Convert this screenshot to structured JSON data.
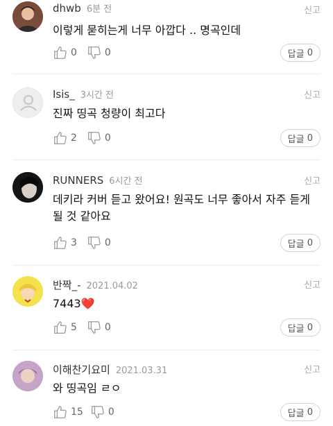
{
  "ui": {
    "like_icon": "thumbs-up-icon",
    "dislike_icon": "thumbs-down-icon",
    "accent": "#e33e3e"
  },
  "comments": [
    {
      "user": "dhwb",
      "time": "6분 전",
      "report": "신고",
      "text": "이렇게 묻히는게 너무 아깝다 .. 명곡인데",
      "likes": "0",
      "dislikes": "0",
      "reply_label": "답글",
      "reply_count": "0"
    },
    {
      "user": "Isis_",
      "time": "3시간 전",
      "report": "신고",
      "text": "진짜 띵곡 청량이 최고다",
      "likes": "2",
      "dislikes": "0",
      "reply_label": "답글",
      "reply_count": "0"
    },
    {
      "user": "RUNNERS",
      "time": "6시간 전",
      "report": "신고",
      "text": "데키라 커버 듣고 왔어요! 원곡도 너무 좋아서 자주 듣게 될 것 같아요",
      "likes": "3",
      "dislikes": "0",
      "reply_label": "답글",
      "reply_count": "0"
    },
    {
      "user": "반짝_-",
      "time": "2021.04.02",
      "report": "신고",
      "text": "7443",
      "emoji": "❤️",
      "likes": "5",
      "dislikes": "0",
      "reply_label": "답글",
      "reply_count": "0"
    },
    {
      "user": "이해찬기요미",
      "time": "2021.03.31",
      "report": "신고",
      "text": "와 띵곡임 ㄹㅇ",
      "likes": "15",
      "dislikes": "0",
      "reply_label": "답글",
      "reply_count": "0"
    }
  ]
}
